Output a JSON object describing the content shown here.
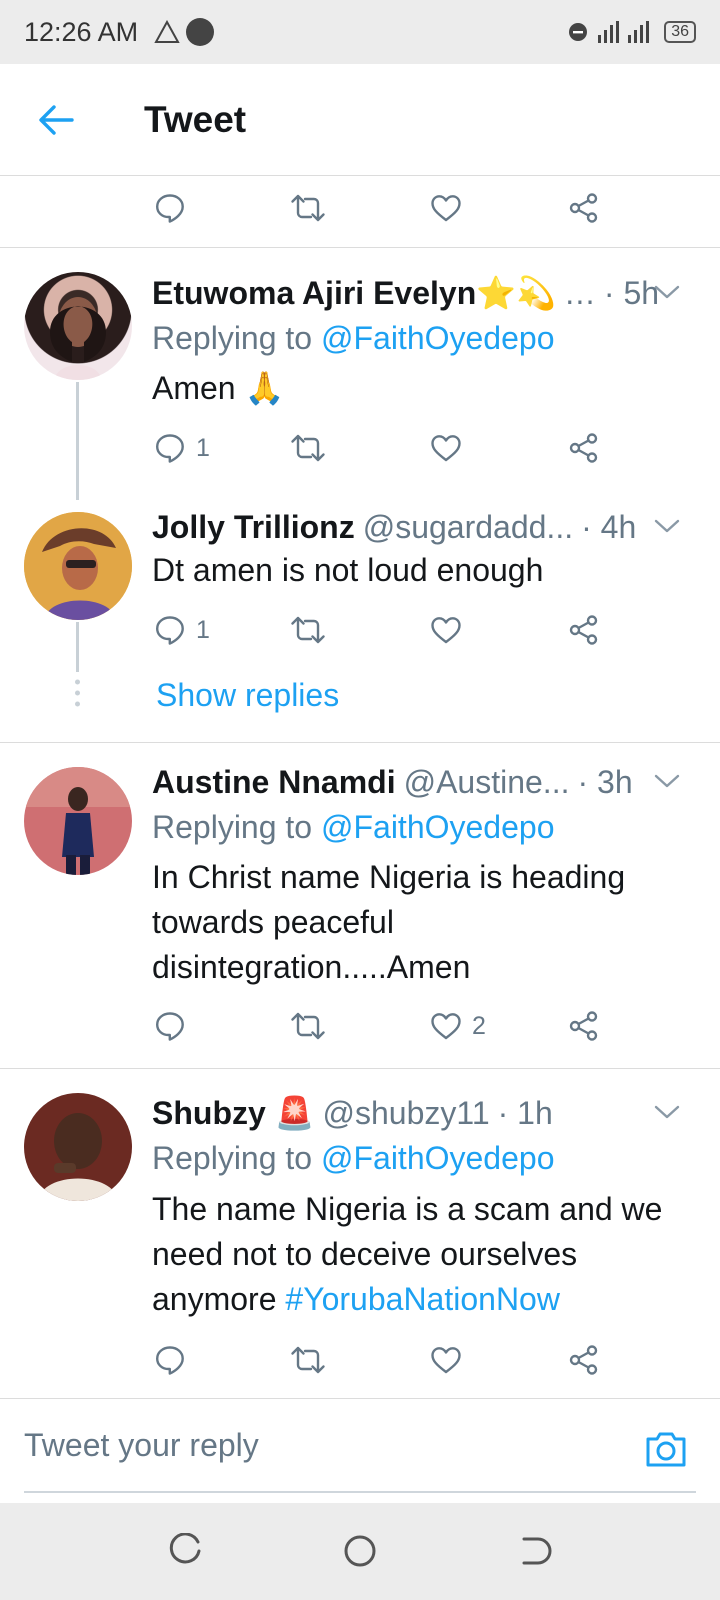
{
  "status_bar": {
    "time": "12:26 AM",
    "battery": "36"
  },
  "app_bar": {
    "title": "Tweet"
  },
  "tweets": [
    {
      "name": "Etuwoma Ajiri Evelyn⭐💫",
      "handle": "…",
      "time": "· 5h",
      "replying_label": "Replying to",
      "replying_to": "@FaithOyedepo",
      "text": "Amen 🙏",
      "reply_count": "1",
      "retweet_count": "",
      "like_count": ""
    },
    {
      "name": "Jolly Trillionz",
      "handle": "@sugardadd...",
      "time": "· 4h",
      "text": "Dt amen is not loud enough",
      "reply_count": "1",
      "retweet_count": "",
      "like_count": ""
    },
    {
      "name": "Austine Nnamdi",
      "handle": "@Austine...",
      "time": "· 3h",
      "replying_label": "Replying to",
      "replying_to": "@FaithOyedepo",
      "text": "In Christ name Nigeria is heading towards peaceful disintegration.....Amen",
      "reply_count": "",
      "retweet_count": "",
      "like_count": "2"
    },
    {
      "name": "Shubzy 🚨",
      "handle": "@shubzy11",
      "time": "· 1h",
      "replying_label": "Replying to",
      "replying_to": "@FaithOyedepo",
      "text": "The name Nigeria is a scam and we need not to deceive ourselves anymore ",
      "hashtag": "#YorubaNationNow",
      "reply_count": "",
      "retweet_count": "",
      "like_count": ""
    }
  ],
  "show_replies": "Show replies",
  "compose": {
    "placeholder": "Tweet your reply"
  },
  "colors": {
    "accent": "#1da1f2",
    "secondary_text": "#657786",
    "primary_text": "#14171a"
  },
  "icons": [
    "back-arrow-icon",
    "reply-icon",
    "retweet-icon",
    "like-icon",
    "share-icon",
    "chevron-down-icon",
    "camera-icon"
  ]
}
